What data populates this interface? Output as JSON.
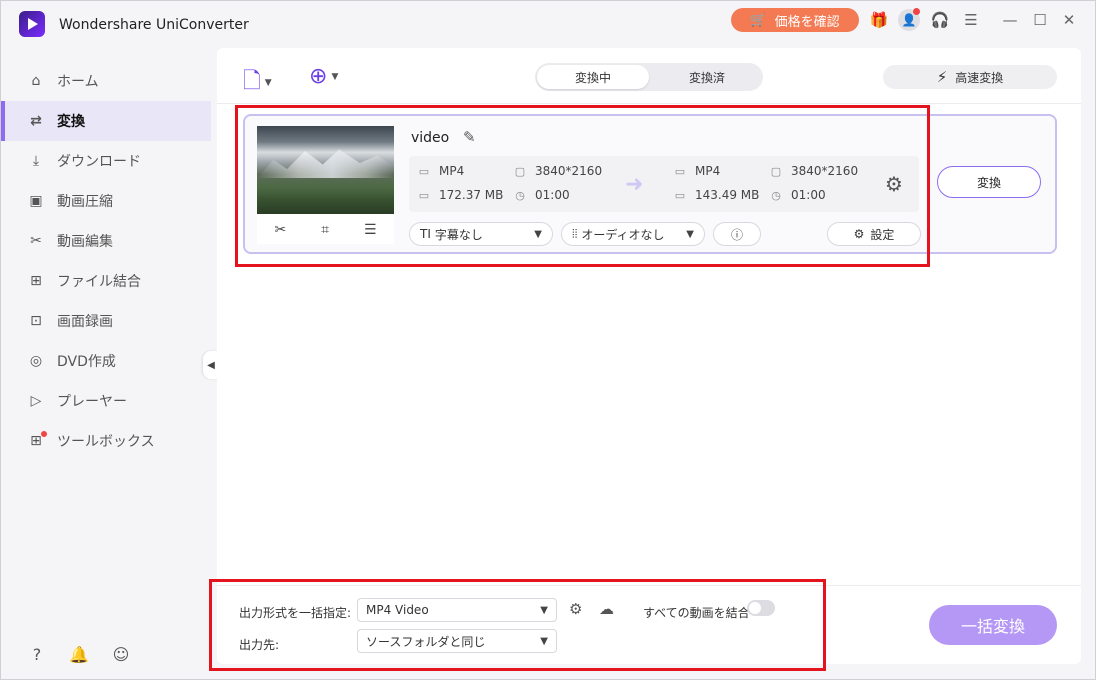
{
  "titlebar": {
    "app_title": "Wondershare UniConverter",
    "price_label": "価格を確認"
  },
  "sidebar": {
    "items": [
      {
        "label": "ホーム",
        "icon": "home-icon"
      },
      {
        "label": "変換",
        "icon": "convert-icon",
        "active": true
      },
      {
        "label": "ダウンロード",
        "icon": "download-icon"
      },
      {
        "label": "動画圧縮",
        "icon": "compress-icon"
      },
      {
        "label": "動画編集",
        "icon": "scissors-icon"
      },
      {
        "label": "ファイル結合",
        "icon": "merge-icon"
      },
      {
        "label": "画面録画",
        "icon": "screen-record-icon"
      },
      {
        "label": "DVD作成",
        "icon": "dvd-icon"
      },
      {
        "label": "プレーヤー",
        "icon": "player-icon"
      },
      {
        "label": "ツールボックス",
        "icon": "toolbox-icon"
      }
    ]
  },
  "toolbar": {
    "tabs": [
      "変換中",
      "変換済"
    ],
    "active_tab": "変換中",
    "fast_convert_label": "高速変換"
  },
  "file": {
    "name": "video",
    "source": {
      "format": "MP4",
      "resolution": "3840*2160",
      "size": "172.37 MB",
      "duration": "01:00"
    },
    "target": {
      "format": "MP4",
      "resolution": "3840*2160",
      "size": "143.49 MB",
      "duration": "01:00"
    },
    "subtitle_label": "字幕なし",
    "audio_label": "オーディオなし",
    "settings_label": "設定",
    "convert_label": "変換"
  },
  "bottom": {
    "output_format_label": "出力形式を一括指定:",
    "output_format_value": "MP4 Video",
    "output_dest_label": "出力先:",
    "output_dest_value": "ソースフォルダと同じ",
    "merge_all_label": "すべての動画を結合",
    "merge_all_on": false,
    "batch_convert_label": "一括変換"
  },
  "colors": {
    "accent": "#8c6df2",
    "price_button": "#f37a52",
    "highlight_frame": "#e4141f",
    "batch_button": "#b597f5"
  }
}
